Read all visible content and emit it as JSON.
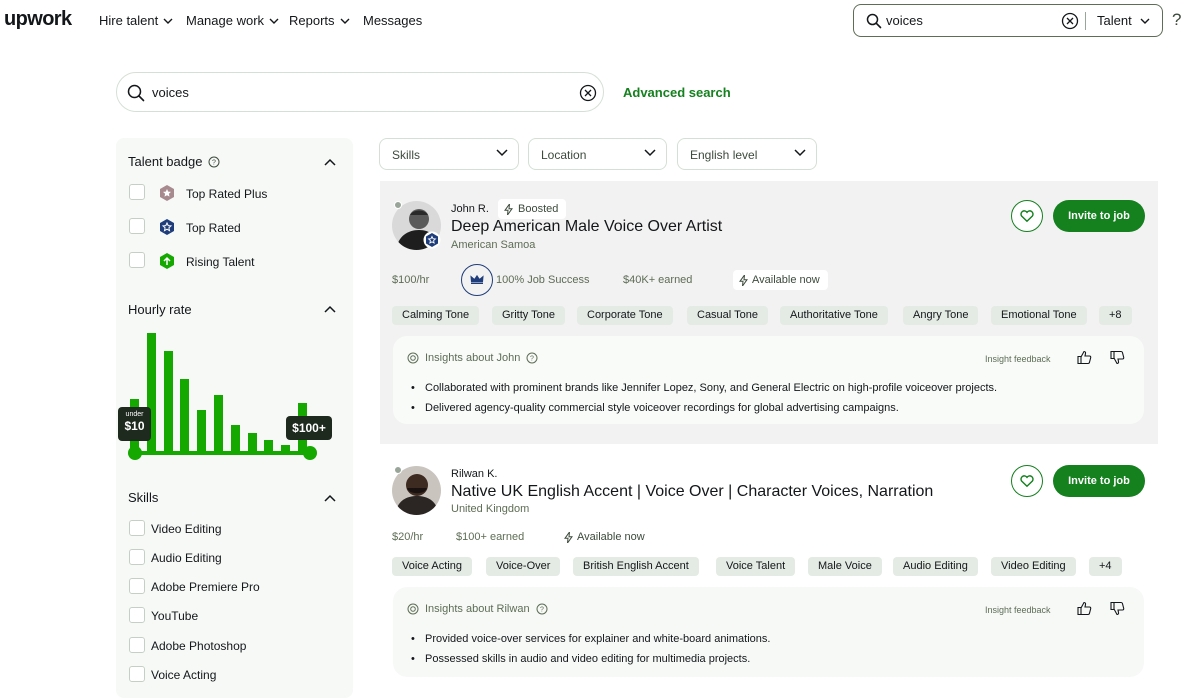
{
  "topnav": {
    "logo": "upwork",
    "items": [
      "Hire talent",
      "Manage work",
      "Reports",
      "Messages"
    ],
    "search_value": "voices",
    "search_scope": "Talent",
    "help": "?"
  },
  "search": {
    "value": "voices",
    "advanced_label": "Advanced search"
  },
  "sidebar": {
    "talent_badge": {
      "title": "Talent badge",
      "options": [
        "Top Rated Plus",
        "Top Rated",
        "Rising Talent"
      ]
    },
    "hourly_rate": {
      "title": "Hourly rate",
      "histogram": [
        0.33,
        0.73,
        0.62,
        0.45,
        0.26,
        0.35,
        0.17,
        0.12,
        0.08,
        0.05,
        0.3
      ],
      "min_label_small": "under",
      "min_label": "$10",
      "max_label": "$100+"
    },
    "skills": {
      "title": "Skills",
      "options": [
        "Video Editing",
        "Audio Editing",
        "Adobe Premiere Pro",
        "YouTube",
        "Adobe Photoshop",
        "Voice Acting"
      ]
    }
  },
  "filters": [
    "Skills",
    "Location",
    "English level"
  ],
  "results": [
    {
      "name": "John R.",
      "boosted": "Boosted",
      "title": "Deep American Male Voice Over Artist",
      "country": "American Samoa",
      "rate": "$100/hr",
      "job_success": "100% Job Success",
      "earned": "$40K+ earned",
      "available": "Available now",
      "invite": "Invite to job",
      "tags": [
        "Calming Tone",
        "Gritty Tone",
        "Corporate Tone",
        "Casual Tone",
        "Authoritative Tone",
        "Angry Tone",
        "Emotional Tone",
        "+8"
      ],
      "insights_title": "Insights about John",
      "feedback_label": "Insight feedback",
      "bullets": [
        "Collaborated with prominent brands like Jennifer Lopez, Sony, and General Electric on high-profile voiceover projects.",
        "Delivered agency-quality commercial style voiceover recordings for global advertising campaigns."
      ]
    },
    {
      "name": "Rilwan K.",
      "title": "Native UK English Accent | Voice Over | Character Voices, Narration",
      "country": "United Kingdom",
      "rate": "$20/hr",
      "earned": "$100+ earned",
      "available": "Available now",
      "invite": "Invite to job",
      "tags": [
        "Voice Acting",
        "Voice-Over",
        "British English Accent",
        "Voice Talent",
        "Male Voice",
        "Audio Editing",
        "Video Editing",
        "+4"
      ],
      "insights_title": "Insights about Rilwan",
      "feedback_label": "Insight feedback",
      "bullets": [
        "Provided voice-over services for explainer and white-board animations.",
        "Possessed skills in audio and video editing for multimedia projects."
      ]
    }
  ],
  "colors": {
    "brand_green": "#14801e",
    "bar_green": "#14a800",
    "top_rated_blue": "#1f3d7a"
  }
}
